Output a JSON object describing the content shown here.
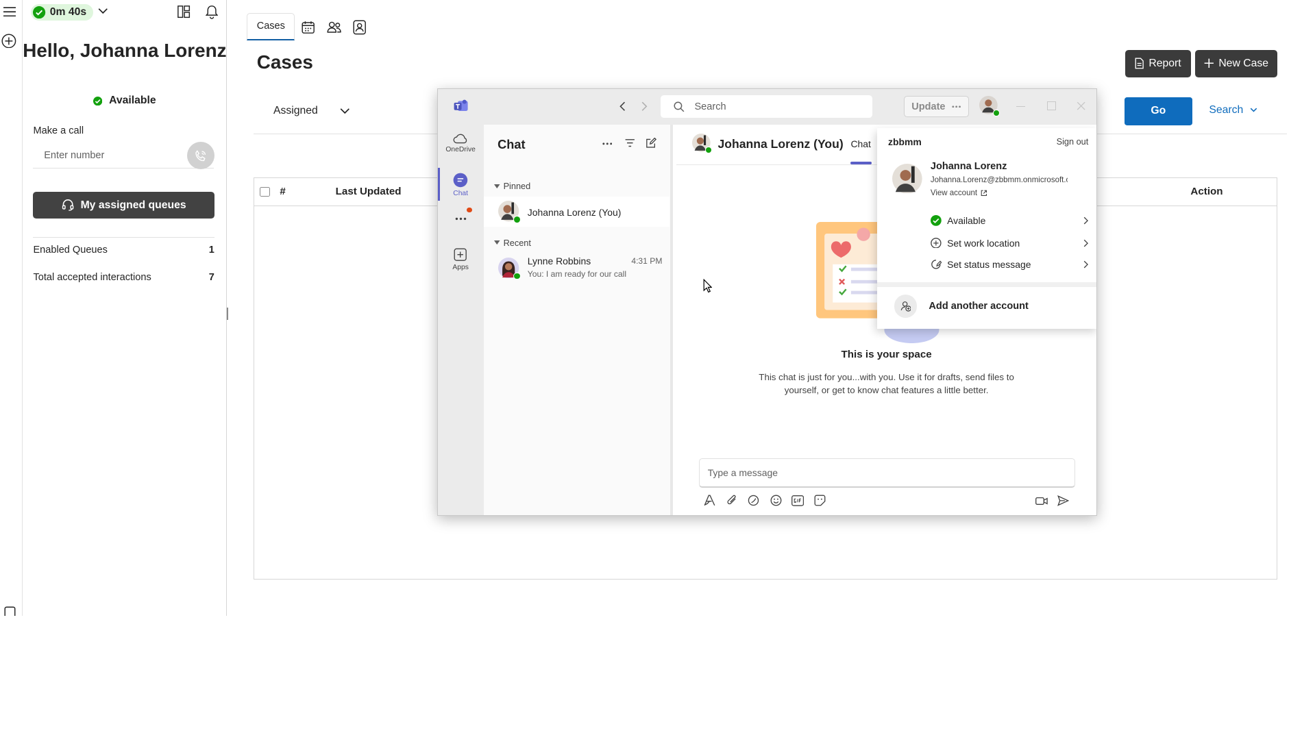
{
  "agent_panel": {
    "timer": "0m 40s",
    "greeting": "Hello, Johanna Lorenz",
    "status": "Available",
    "make_call_label": "Make a call",
    "number_placeholder": "Enter number",
    "queues_button": "My assigned queues",
    "stats": [
      {
        "label": "Enabled Queues",
        "value": "1"
      },
      {
        "label": "Total accepted interactions",
        "value": "7"
      }
    ]
  },
  "main": {
    "tab": "Cases",
    "page_title": "Cases",
    "report_button": "Report",
    "new_case_button": "New Case",
    "filter_value": "Assigned",
    "go_button": "Go",
    "search_link": "Search",
    "columns": {
      "number": "#",
      "last_updated": "Last Updated",
      "action": "Action"
    }
  },
  "teams": {
    "search_placeholder": "Search",
    "update_button": "Update",
    "rail": [
      {
        "label": "OneDrive",
        "icon": "cloud-icon"
      },
      {
        "label": "Chat",
        "icon": "chat-icon"
      },
      {
        "label": "Apps",
        "icon": "apps-icon"
      }
    ],
    "chat_title": "Chat",
    "pinned_label": "Pinned",
    "recent_label": "Recent",
    "pinned_chats": [
      {
        "name": "Johanna Lorenz (You)"
      }
    ],
    "recent_chats": [
      {
        "name": "Lynne Robbins",
        "time": "4:31 PM",
        "preview": "You: I am ready for our call"
      }
    ],
    "conversation": {
      "title": "Johanna Lorenz (You)",
      "tab": "Chat",
      "space_title": "This is your space",
      "space_text": "This chat is just for you...with you. Use it for drafts, send files to yourself, or get to know chat features a little better.",
      "message_placeholder": "Type a message"
    },
    "account": {
      "org": "zbbmm",
      "sign_out": "Sign out",
      "name": "Johanna Lorenz",
      "email": "Johanna.Lorenz@zbbmm.onmicrosoft.com",
      "view_account": "View account",
      "items": [
        "Available",
        "Set work location",
        "Set status message"
      ],
      "add_account": "Add another account"
    }
  },
  "colors": {
    "accent_blue": "#0f6cbd",
    "teams_purple": "#5b5fc7",
    "available_green": "#13a10e",
    "dark_button": "#3b3b3b"
  }
}
